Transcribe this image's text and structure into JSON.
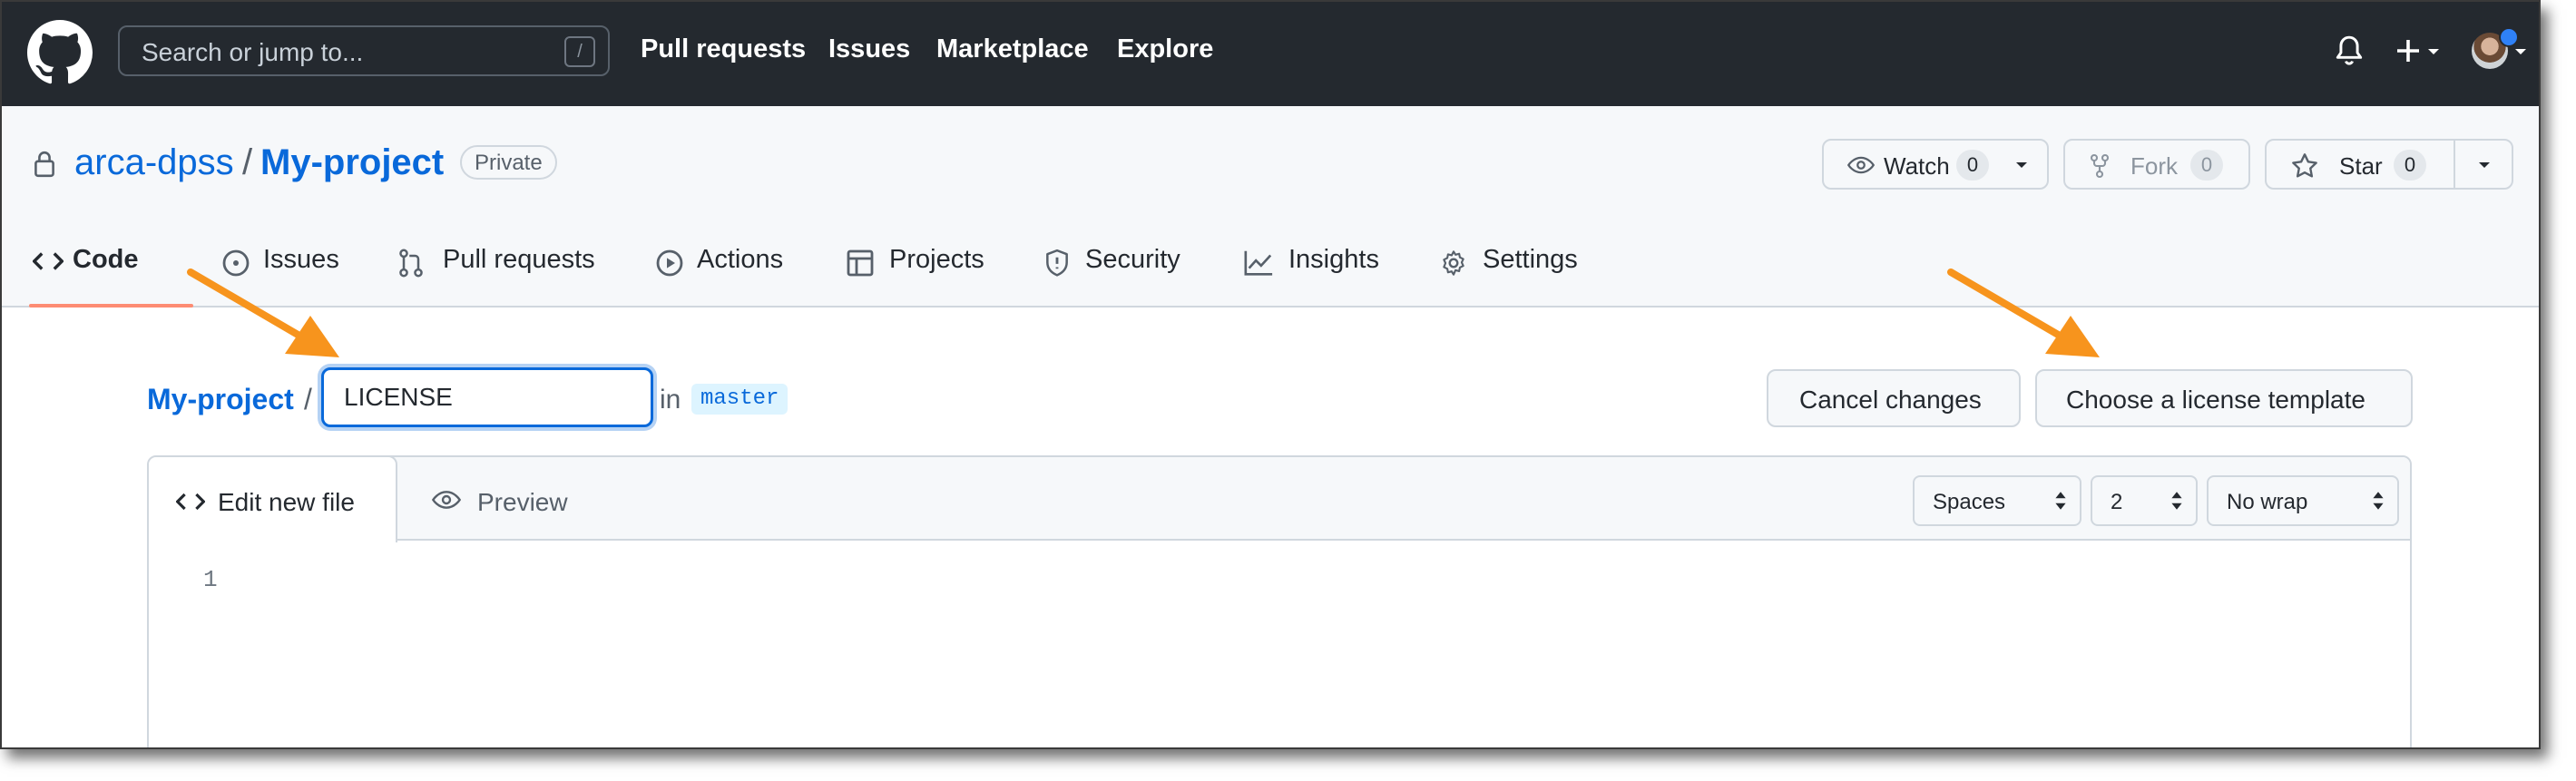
{
  "header": {
    "search_placeholder": "Search or jump to...",
    "search_shortcut": "/",
    "nav": [
      "Pull requests",
      "Issues",
      "Marketplace",
      "Explore"
    ]
  },
  "repo": {
    "owner": "arca-dpss",
    "separator": "/",
    "name": "My-project",
    "visibility": "Private",
    "watch_label": "Watch",
    "watch_count": "0",
    "fork_label": "Fork",
    "fork_count": "0",
    "star_label": "Star",
    "star_count": "0"
  },
  "tabs": [
    "Code",
    "Issues",
    "Pull requests",
    "Actions",
    "Projects",
    "Security",
    "Insights",
    "Settings"
  ],
  "editor": {
    "breadcrumb_repo": "My-project",
    "breadcrumb_sep": "/",
    "filename": "LICENSE",
    "in_label": "in",
    "branch": "master",
    "cancel_label": "Cancel changes",
    "template_label": "Choose a license template",
    "tab_edit": "Edit new file",
    "tab_preview": "Preview",
    "indent_mode": "Spaces",
    "indent_size": "2",
    "wrap_mode": "No wrap",
    "line_number": "1"
  },
  "colors": {
    "header_bg": "#24292f",
    "link": "#0969da",
    "annotation_arrow": "#f7941d",
    "active_tab_underline": "#fd8c73"
  }
}
